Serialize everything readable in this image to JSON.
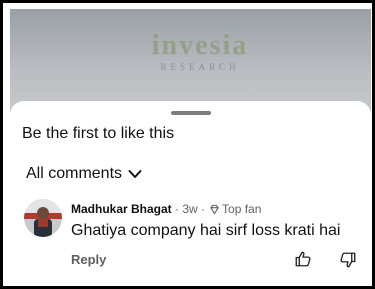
{
  "background": {
    "brand_name": "invesia",
    "brand_sub": "RESEARCH"
  },
  "sheet": {
    "likes_text": "Be the first to like this",
    "comments_header": "All comments"
  },
  "comment": {
    "author": "Madhukar Bhagat",
    "age": "· 3w ·",
    "badge": "Top fan",
    "text": "Ghatiya company hai sirf loss krati hai",
    "reply_label": "Reply"
  },
  "icons": [
    "chevron-down-icon",
    "diamond-icon",
    "thumbs-up-icon",
    "thumbs-down-icon"
  ],
  "colors": {
    "backdrop": "#9aa0a6",
    "meta_text": "#606060",
    "primary_text": "#111111"
  }
}
